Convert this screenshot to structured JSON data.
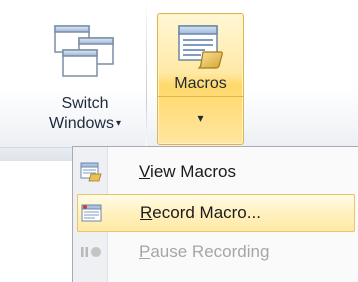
{
  "ribbon": {
    "switch_windows": {
      "line1": "Switch",
      "line2": "Windows",
      "caret": "▾",
      "icon": "switch-windows-icon"
    },
    "macros": {
      "label": "Macros",
      "caret": "▾",
      "icon": "macros-icon"
    }
  },
  "menu": {
    "items": [
      {
        "first": "V",
        "rest": "iew Macros",
        "icon": "view-macros-icon",
        "state": "normal"
      },
      {
        "first": "R",
        "rest": "ecord Macro...",
        "icon": "record-macro-icon",
        "state": "hover"
      },
      {
        "first": "P",
        "rest": "ause Recording",
        "icon": "pause-recording-icon",
        "state": "disabled"
      }
    ]
  },
  "colors": {
    "hover_fill": "#ffe9a5",
    "hover_border": "#e3b24a",
    "disabled_text": "#a6a6a6"
  }
}
